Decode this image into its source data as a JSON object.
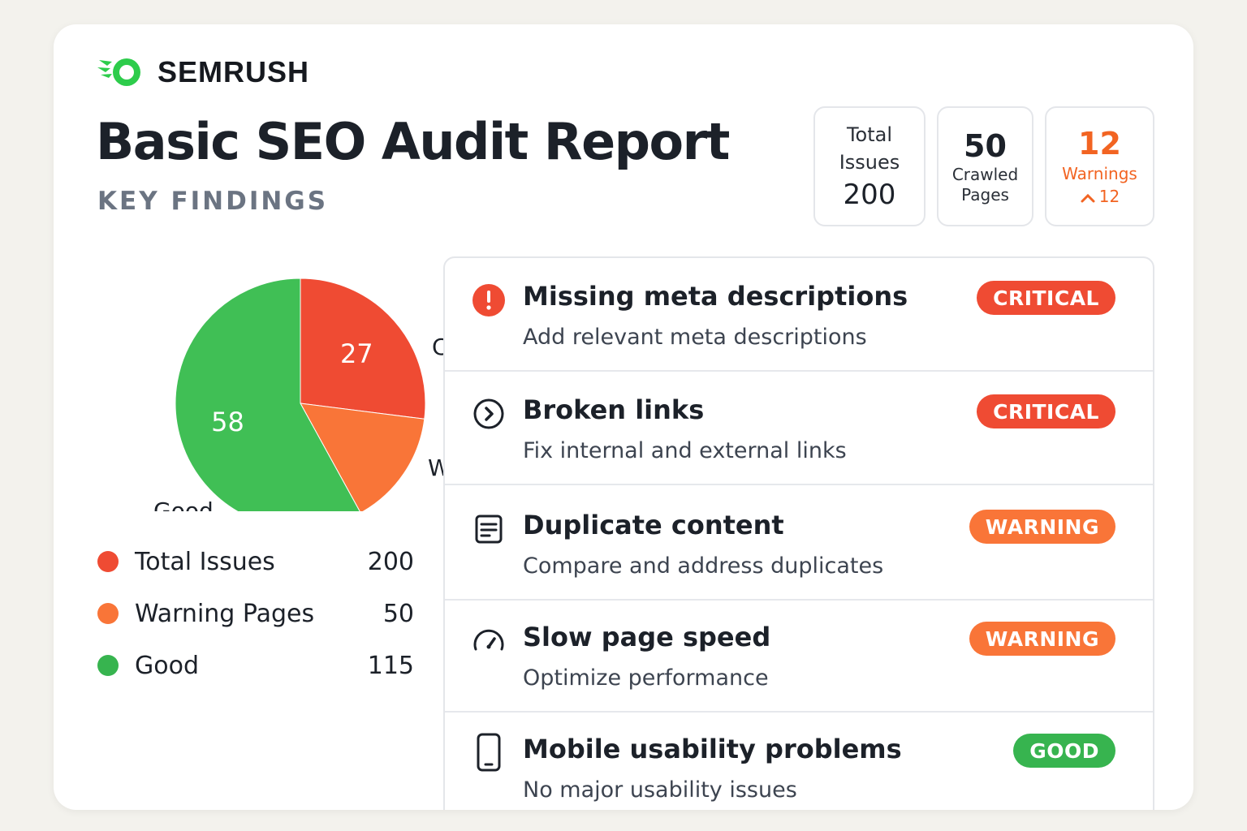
{
  "brand": {
    "name": "SEMRUSH",
    "logo_color": "#2dcc4b"
  },
  "header": {
    "title": "Basic SEO Audit Report",
    "section_label": "KEY FINDINGS"
  },
  "stats": [
    {
      "label": "Total Issues",
      "value": "200"
    },
    {
      "value": "50",
      "label": "Crawled Pages"
    },
    {
      "value": "12",
      "label": "Warnings",
      "trend": "12",
      "trend_icon": "chevron-up-icon",
      "color": "#f26422"
    }
  ],
  "chart_data": {
    "type": "pie",
    "slices": [
      {
        "label": "Crit",
        "value": 27,
        "color": "#ef4b33",
        "value_label": "27"
      },
      {
        "label": "Warn",
        "value": 15,
        "color": "#f97538",
        "value_label": ""
      },
      {
        "label": "Good",
        "value": 58,
        "color": "#40bf55",
        "value_label": "58"
      }
    ]
  },
  "legend": [
    {
      "label": "Total Issues",
      "value": "200",
      "color": "#ef4b33"
    },
    {
      "label": "Warning Pages",
      "value": "50",
      "color": "#f97538"
    },
    {
      "label": "Good",
      "value": "115",
      "color": "#37b44f"
    }
  ],
  "issues": [
    {
      "title": "Missing meta descriptions",
      "subtitle": "Add relevant meta descriptions",
      "badge": "CRITICAL",
      "status": "critical",
      "icon": "alert-icon"
    },
    {
      "title": "Broken links",
      "subtitle": "Fix internal and external links",
      "badge": "CRITICAL",
      "status": "critical",
      "icon": "arrow-circle-icon"
    },
    {
      "title": "Duplicate content",
      "subtitle": "Compare and address duplicates",
      "badge": "WARNING",
      "status": "warning",
      "icon": "document-icon"
    },
    {
      "title": "Slow page speed",
      "subtitle": "Optimize performance",
      "badge": "WARNING",
      "status": "warning",
      "icon": "speedometer-icon"
    },
    {
      "title": "Mobile usability problems",
      "subtitle": "No major usability issues",
      "badge": "GOOD",
      "status": "good",
      "icon": "mobile-icon"
    }
  ]
}
